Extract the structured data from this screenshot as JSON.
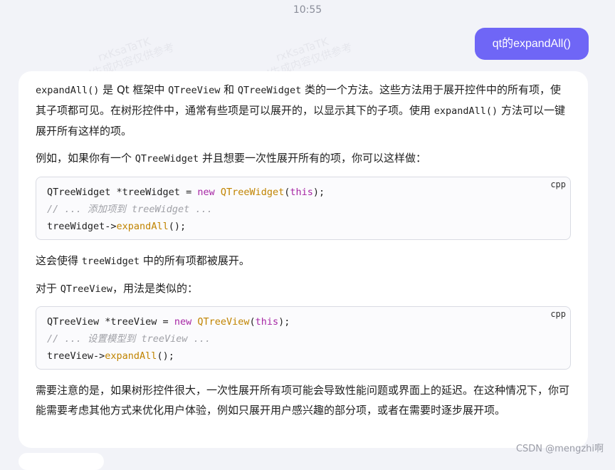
{
  "status": {
    "time": "10:55"
  },
  "user_message": {
    "text": "qt的expandAll()"
  },
  "answer": {
    "p1_parts": [
      "expandAll()",
      " 是 Qt 框架中 ",
      "QTreeView",
      " 和 ",
      "QTreeWidget",
      " 类的一个方法。这些方法用于展开控件中的所有项，使其子项都可见。在树形控件中，通常有些项是可以展开的，以显示其下的子项。使用 ",
      "expandAll()",
      " 方法可以一键展开所有这样的项。"
    ],
    "p2_parts": [
      "例如，如果你有一个 ",
      "QTreeWidget",
      " 并且想要一次性展开所有的项，你可以这样做："
    ],
    "code1": {
      "lang": "cpp",
      "l1": [
        "QTreeWidget *treeWidget = ",
        "new",
        " ",
        "QTreeWidget",
        "(",
        "this",
        ");"
      ],
      "l2": "// ... 添加项到 treeWidget ...",
      "l3": [
        "treeWidget->",
        "expandAll",
        "();"
      ]
    },
    "p3_parts": [
      "这会使得 ",
      "treeWidget",
      " 中的所有项都被展开。"
    ],
    "p4_parts": [
      "对于 ",
      "QTreeView",
      "，用法是类似的："
    ],
    "code2": {
      "lang": "cpp",
      "l1": [
        "QTreeView *treeView = ",
        "new",
        " ",
        "QTreeView",
        "(",
        "this",
        ");"
      ],
      "l2": "// ... 设置模型到 treeView ...",
      "l3": [
        "treeView->",
        "expandAll",
        "();"
      ]
    },
    "p5": "需要注意的是，如果树形控件很大，一次性展开所有项可能会导致性能问题或界面上的延迟。在这种情况下，你可能需要考虑其他方式来优化用户体验，例如只展开用户感兴趣的部分项，或者在需要时逐步展开项。"
  },
  "watermark": {
    "line1": "rxKsaTaTK",
    "line2": "AI生成内容仅供参考"
  },
  "footer": {
    "credit": "CSDN @mengzhi啊"
  }
}
